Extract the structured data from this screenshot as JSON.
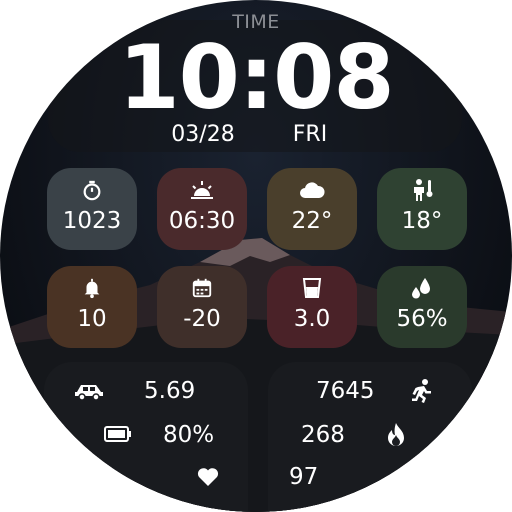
{
  "time": {
    "label": "TIME",
    "value": "10:08",
    "date": "03/28",
    "day": "FRI"
  },
  "tiles": [
    {
      "name": "pressure",
      "icon": "stopwatch-icon",
      "value": "1023",
      "color": "#3a4248"
    },
    {
      "name": "sunrise",
      "icon": "sunrise-icon",
      "value": "06:30",
      "color": "#4a2a2c"
    },
    {
      "name": "weather",
      "icon": "cloud-icon",
      "value": "22°",
      "color": "#4a3f2c"
    },
    {
      "name": "feels-like",
      "icon": "person-temperature-icon",
      "value": "18°",
      "color": "#2f4232"
    },
    {
      "name": "notifications",
      "icon": "bell-icon",
      "value": "10",
      "color": "#4a3324"
    },
    {
      "name": "calendar",
      "icon": "calendar-icon",
      "value": "-20",
      "color": "#3f2f2a"
    },
    {
      "name": "water",
      "icon": "glass-icon",
      "value": "3.0",
      "color": "#4a2228"
    },
    {
      "name": "humidity",
      "icon": "droplets-icon",
      "value": "56%",
      "color": "#2a3a2c"
    }
  ],
  "stats": {
    "distance": {
      "icon": "car-icon",
      "value": "5.69"
    },
    "battery": {
      "icon": "battery-icon",
      "value": "80%"
    },
    "heart_rate": {
      "icon": "heart-icon",
      "value": "97"
    },
    "steps": {
      "icon": "running-icon",
      "value": "7645"
    },
    "calories": {
      "icon": "fire-icon",
      "value": "268"
    }
  }
}
